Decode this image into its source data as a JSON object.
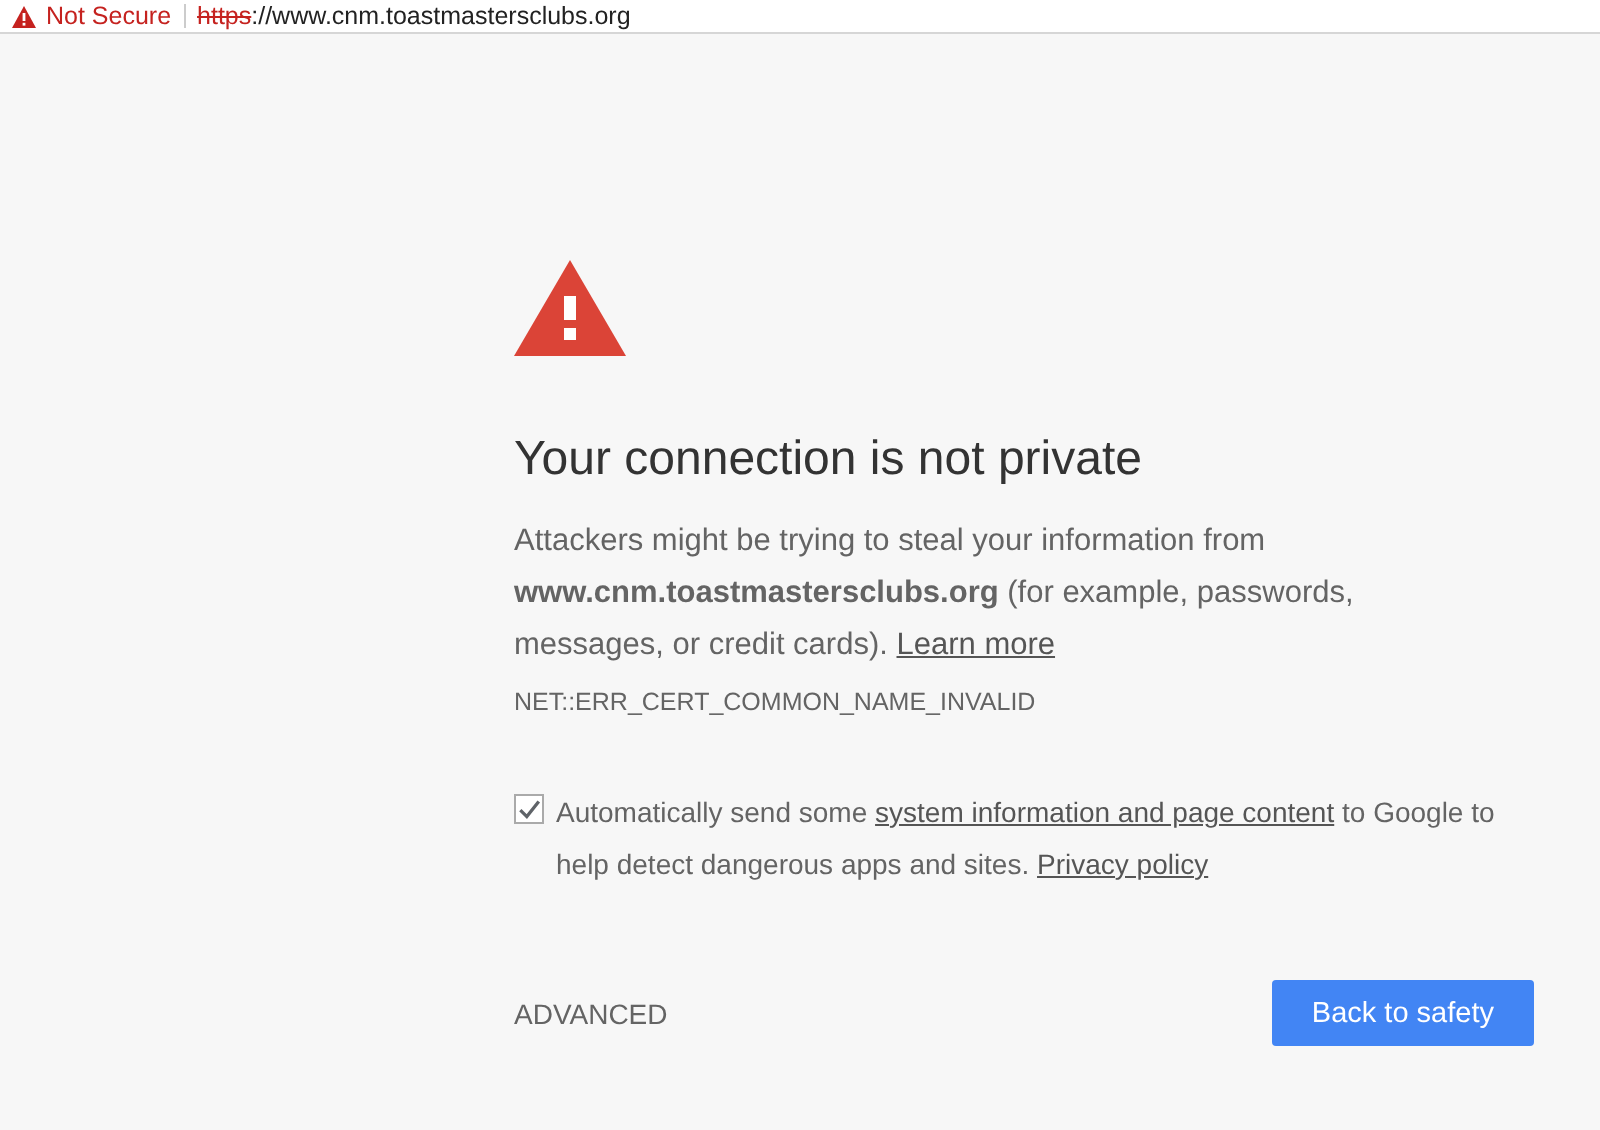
{
  "address_bar": {
    "security_label": "Not Secure",
    "scheme": "https",
    "url_rest": "://www.cnm.toastmastersclubs.org"
  },
  "heading": "Your connection is not private",
  "message": {
    "text": "Attackers might be trying to steal your information from **www.cnm.toastmastersclubs.org** (for example, passwords, messages, or credit cards).",
    "link": "Learn more"
  },
  "error_code": "NET::ERR_CERT_COMMON_NAME_INVALID",
  "consent": {
    "checked": true,
    "parts": [
      {
        "kind": "text",
        "text": "Automatically send some"
      },
      {
        "kind": "link",
        "text": "system information and page content"
      },
      {
        "kind": "text",
        "text": "to Google to help detect dangerous apps and sites."
      },
      {
        "kind": "link",
        "text": "Privacy policy"
      }
    ]
  },
  "advanced_button": "ADVANCED",
  "primary_button": "Back to safety"
}
